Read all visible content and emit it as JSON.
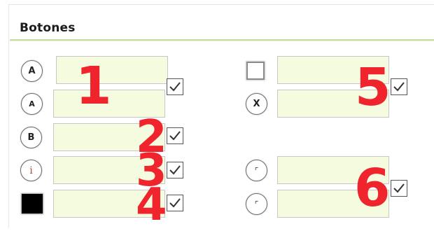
{
  "section": {
    "title": "Botones"
  },
  "buttons": {
    "b1": "A",
    "b2": "A",
    "b3": "B",
    "b4": "i",
    "b5": "X",
    "b6": "⌜",
    "b7": "⌜"
  },
  "labels": [
    "1",
    "2",
    "3",
    "4",
    "5",
    "6"
  ],
  "checkboxes": {
    "cb1": true,
    "cb2": true,
    "cb3": true,
    "cb4": true,
    "cb5": true,
    "cb6": true
  },
  "colors": {
    "number_red": "#f0242c",
    "field_bg": "#f5fbdf",
    "title_rule": "#c8dca0"
  }
}
